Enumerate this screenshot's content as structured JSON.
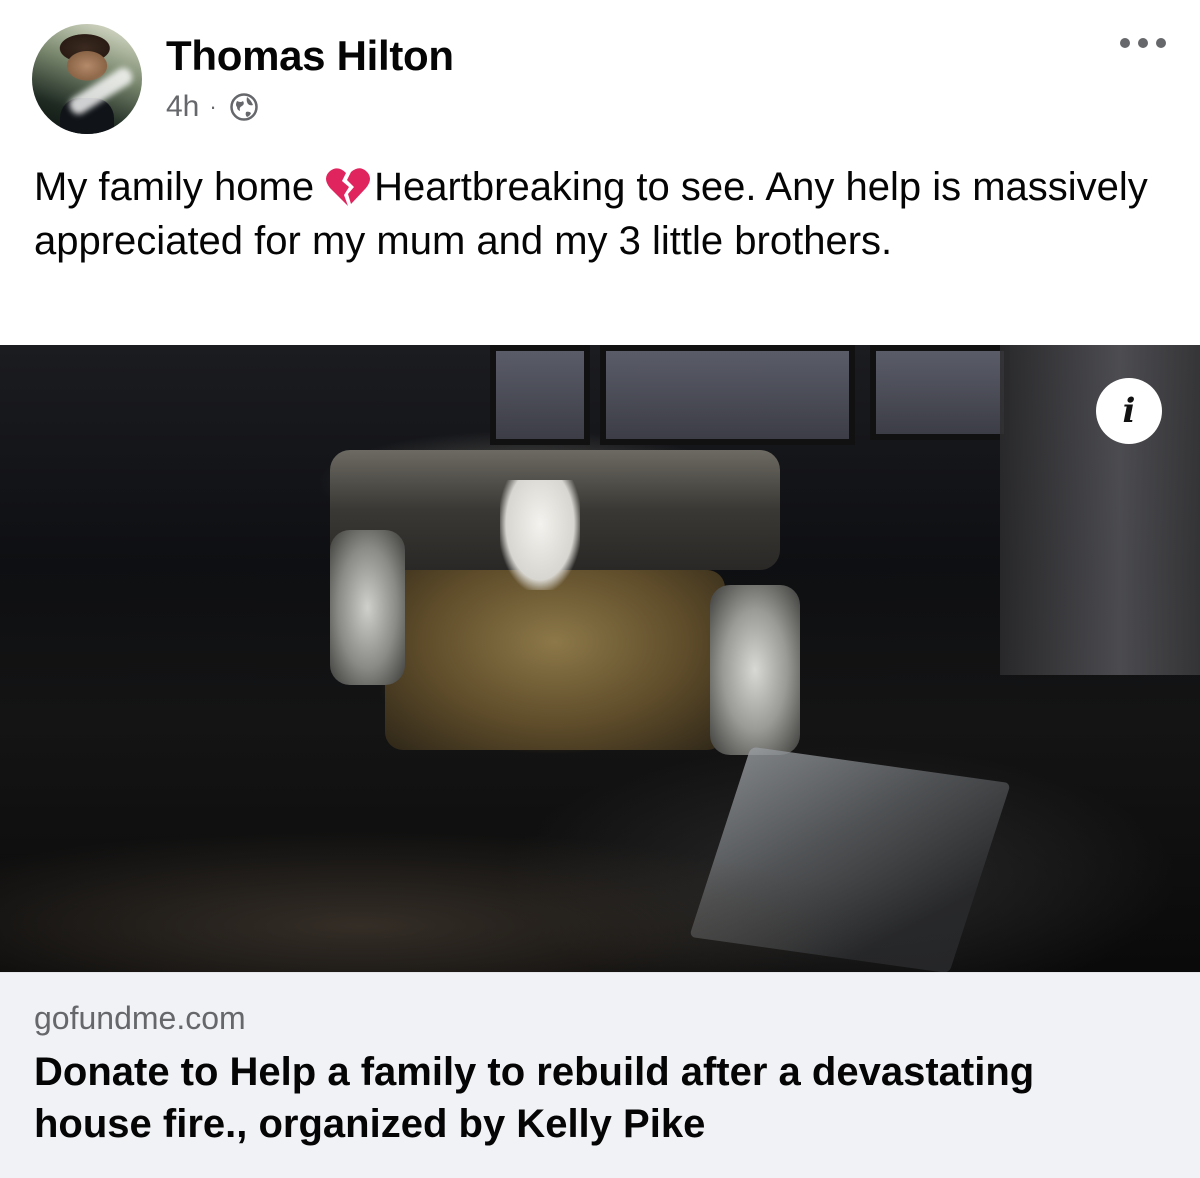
{
  "post": {
    "author": "Thomas Hilton",
    "time": "4h",
    "separator": "·",
    "privacy_icon": "globe-icon",
    "text_before_emoji": "My family home",
    "emoji": "broken-heart-icon",
    "text_after_emoji": "Heartbreaking to see. Any help is massively appreciated for my mum and my 3 little brothers."
  },
  "link": {
    "domain": "gofundme.com",
    "title": "Donate to Help a family to rebuild after a devastating house fire., organized by Kelly Pike"
  },
  "photo": {
    "info_label": "i"
  },
  "colors": {
    "secondary_text": "#65676b",
    "link_card_bg": "#f0f2f5",
    "emoji_red": "#e0245e"
  }
}
